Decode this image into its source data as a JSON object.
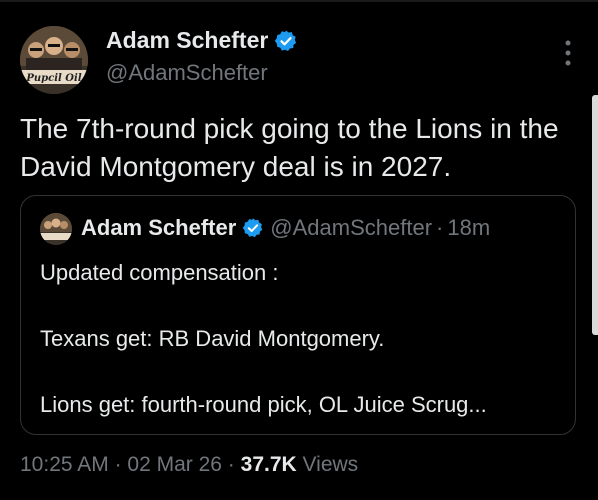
{
  "author": {
    "name": "Adam Schefter",
    "handle": "@AdamSchefter",
    "avatar_caption": "Pupcil Oil"
  },
  "tweet": {
    "text": "The 7th-round pick going to the Lions in the David Montgomery deal is in 2027."
  },
  "quote": {
    "name": "Adam Schefter",
    "handle": "@AdamSchefter",
    "separator": "·",
    "time": "18m",
    "lines": [
      "Updated compensation :",
      "",
      "Texans get: RB David Montgomery.",
      "",
      "Lions get: fourth-round pick, OL Juice Scrug..."
    ]
  },
  "meta": {
    "time": "10:25 AM",
    "sep1": " · ",
    "date": "02 Mar 26",
    "sep2": " · ",
    "views_count": "37.7K",
    "views_label": " Views"
  },
  "colors": {
    "background": "#000000",
    "text": "#e7e9ea",
    "muted": "#71767b",
    "verified": "#1d9bf0",
    "border": "#2f3336"
  }
}
